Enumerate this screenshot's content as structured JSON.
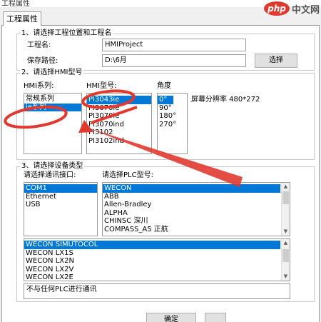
{
  "window": {
    "title": "工程属性"
  },
  "watermark": {
    "text": "中文网",
    "badge": "php"
  },
  "tabs": [
    {
      "label": "工程属性"
    }
  ],
  "section1": {
    "legend": "1、请选择工程位置和工程名",
    "name_label": "工程名:",
    "name_value": "HMIProject",
    "path_label": "保存路径:",
    "path_value": "D:\\6月",
    "browse_button": "选择"
  },
  "section2": {
    "legend": "2、请选择HMI型号",
    "series_label": "HMI系列:",
    "series": [
      {
        "label": "常规系列",
        "selected": false
      },
      {
        "label": "ie系列",
        "selected": true
      }
    ],
    "model_label": "HMI型号:",
    "models": [
      {
        "label": "PI3043ie",
        "selected": true
      },
      {
        "label": "PI3070ie",
        "selected": false
      },
      {
        "label": "PI3070ie",
        "selected": false
      },
      {
        "label": "PI3070ind",
        "selected": false
      },
      {
        "label": "PI3102",
        "selected": false
      },
      {
        "label": "PI3102ind",
        "selected": false
      }
    ],
    "angle_label": "角度",
    "angles": [
      {
        "label": "0°",
        "selected": true
      },
      {
        "label": "90°",
        "selected": false
      },
      {
        "label": "180°",
        "selected": false
      },
      {
        "label": "270°",
        "selected": false
      }
    ],
    "resolution_text": "屏幕分辨率 480*272"
  },
  "section3": {
    "legend": "3、请选择设备类型",
    "port_label": "请选择通讯接口:",
    "ports": [
      {
        "label": "COM1",
        "selected": true
      },
      {
        "label": "Ethernet",
        "selected": false
      },
      {
        "label": "USB",
        "selected": false
      }
    ],
    "plc_label": "请选择PLC型号:",
    "plcs": [
      {
        "label": "WECON",
        "selected": true
      },
      {
        "label": "ABB",
        "selected": false
      },
      {
        "label": "Allen-Bradley",
        "selected": false
      },
      {
        "label": "ALPHA",
        "selected": false
      },
      {
        "label": "CHINSC 深川",
        "selected": false
      },
      {
        "label": "COMPASS_A5 正航",
        "selected": false
      }
    ],
    "protocols": [
      {
        "label": "WECON SIMUTOCOL",
        "selected": true
      },
      {
        "label": "WECON LX1S",
        "selected": false
      },
      {
        "label": "WECON LX2N",
        "selected": false
      },
      {
        "label": "WECON LX2V",
        "selected": false
      },
      {
        "label": "WECON LX2E",
        "selected": false
      }
    ],
    "description": "不与任何PLC进行通讯"
  },
  "footer": {
    "ok_button": "确定"
  },
  "colors": {
    "selection": "#0078d7",
    "annotation": "#e03a2f"
  }
}
